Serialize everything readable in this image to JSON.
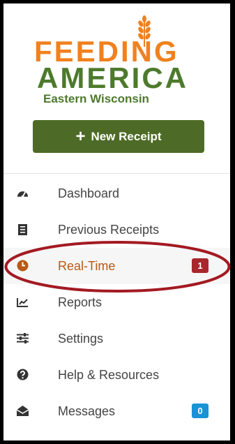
{
  "brand": {
    "line1": "FEEDING",
    "line2": "AMERICA",
    "region": "Eastern Wisconsin",
    "orange": "#f0811f",
    "green": "#4d7a2c"
  },
  "new_receipt": {
    "icon": "plus-icon",
    "label": "New Receipt"
  },
  "nav": {
    "items": [
      {
        "label": "Dashboard",
        "icon": "dashboard-gauge-icon"
      },
      {
        "label": "Previous Receipts",
        "icon": "receipt-icon"
      },
      {
        "label": "Real-Time",
        "icon": "clock-icon",
        "active": true,
        "badge": "1",
        "badge_color": "#a8262c"
      },
      {
        "label": "Reports",
        "icon": "line-chart-icon"
      },
      {
        "label": "Settings",
        "icon": "sliders-icon"
      },
      {
        "label": "Help & Resources",
        "icon": "question-circle-icon"
      },
      {
        "label": "Messages",
        "icon": "envelope-open-icon",
        "badge": "0",
        "badge_color": "#1793d6"
      }
    ]
  },
  "annotation": {
    "color": "#a31a22"
  }
}
